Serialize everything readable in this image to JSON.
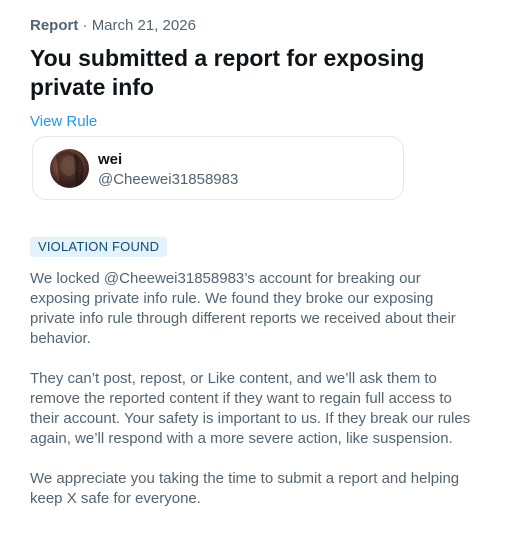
{
  "header": {
    "report_label": "Report",
    "separator": "·",
    "date": "March 21, 2026",
    "title": "You submitted a report for exposing private info",
    "view_rule": "View Rule"
  },
  "reported_user": {
    "name": "wei",
    "handle": "@Cheewei31858983"
  },
  "status": {
    "badge": "VIOLATION FOUND"
  },
  "body": {
    "paragraph_1": "We locked @Cheewei31858983’s account for breaking our exposing private info rule. We found they broke our exposing private info rule through different reports we received about their behavior.",
    "paragraph_2": "They can’t post, repost, or Like content, and we’ll ask them to remove the reported content if they want to regain full access to their account. Your safety is important to us. If they break our rules again, we’ll respond with a more severe action, like suspension.",
    "paragraph_3": "We appreciate you taking the time to submit a report and helping keep X safe for everyone."
  },
  "colors": {
    "text_primary": "#0f1419",
    "text_secondary": "#536471",
    "link": "#1d9bf0",
    "badge_bg": "#e3f2fb",
    "border": "#e1e8ed"
  }
}
